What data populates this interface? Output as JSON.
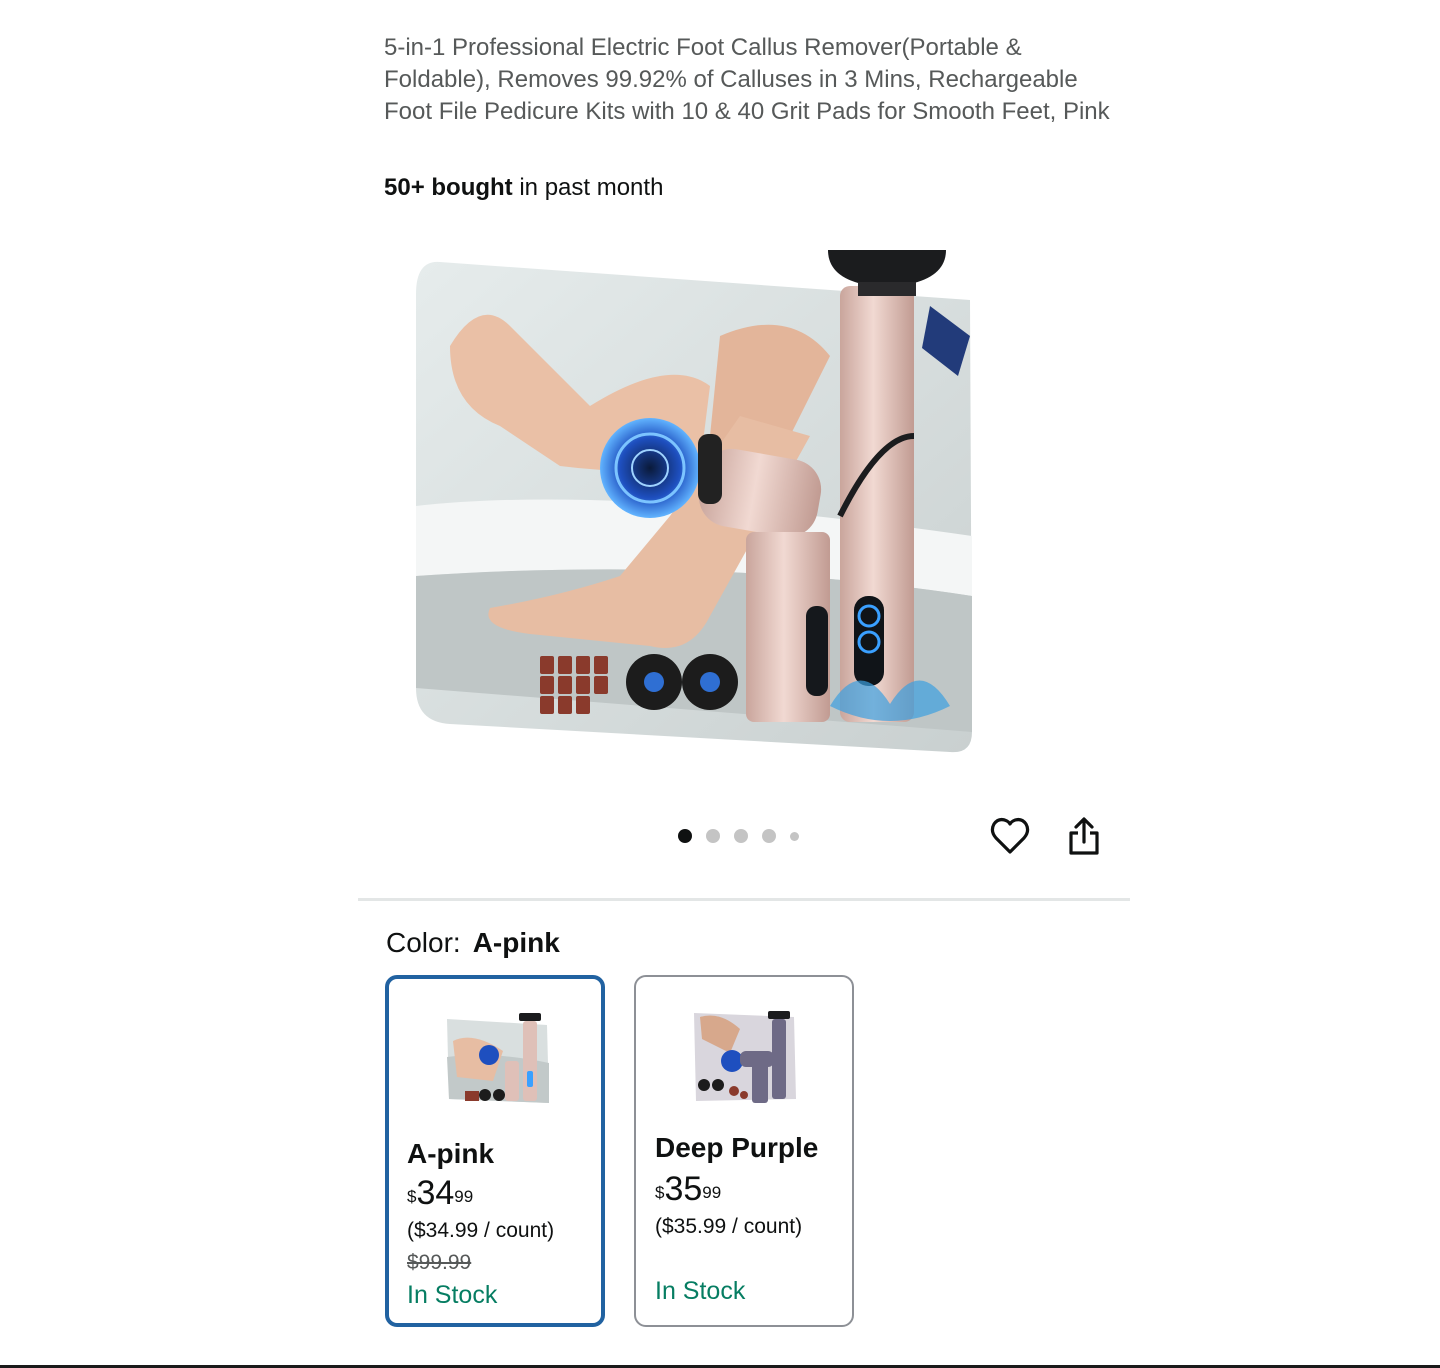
{
  "product": {
    "title": "5-in-1 Professional Electric Foot Callus Remover(Portable & Foldable), Removes 99.92% of Calluses in 3 Mins, Rechargeable Foot File Pedicure Kits with 10 & 40 Grit Pads for Smooth Feet, Pink",
    "bought_bold": "50+ bought",
    "bought_rest": " in past month"
  },
  "carousel": {
    "image_count": 5,
    "active_index": 0
  },
  "icons": {
    "wishlist": "heart-icon",
    "share": "share-icon"
  },
  "color_selector": {
    "label": "Color:",
    "selected": "A-pink",
    "options": [
      {
        "name": "A-pink",
        "price_symbol": "$",
        "price_whole": "34",
        "price_fraction": "99",
        "unit_price": "($34.99 / count)",
        "list_price": "$99.99",
        "stock": "In Stock",
        "selected": true
      },
      {
        "name": "Deep Purple",
        "price_symbol": "$",
        "price_whole": "35",
        "price_fraction": "99",
        "unit_price": "($35.99 / count)",
        "stock": "In Stock",
        "selected": false
      }
    ]
  },
  "colors": {
    "selected_border": "#2162a1",
    "in_stock": "#067d62",
    "device_pink": "#dfc0b8",
    "device_purple": "#6e6a86"
  }
}
